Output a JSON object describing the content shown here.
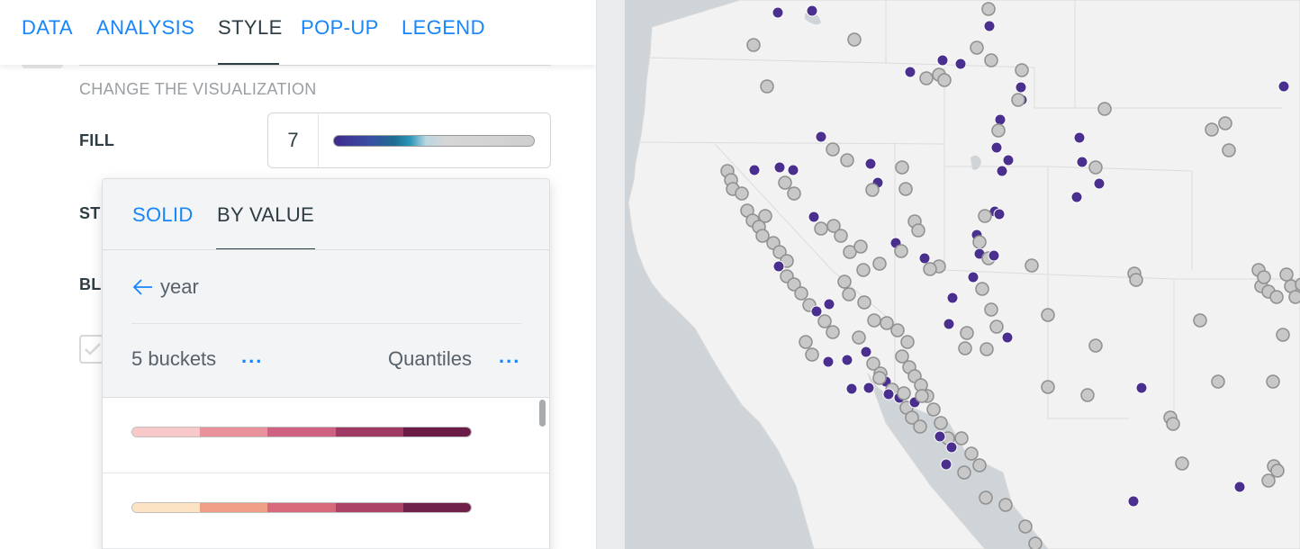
{
  "tabs": [
    {
      "label": "DATA",
      "active": false
    },
    {
      "label": "ANALYSIS",
      "active": false
    },
    {
      "label": "STYLE",
      "active": true
    },
    {
      "label": "POP-UP",
      "active": false
    },
    {
      "label": "LEGEND",
      "active": false
    }
  ],
  "style_panel": {
    "section_title": "CHANGE THE VISUALIZATION",
    "fill_label": "FILL",
    "stroke_label_visible": "ST",
    "blending_label_visible": "BL",
    "fill_count": "7"
  },
  "fill_popup": {
    "tabs": [
      "SOLID",
      "BY VALUE"
    ],
    "active_tab": "BY VALUE",
    "field": "year",
    "buckets": "5 buckets",
    "method": "Quantiles",
    "more_glyph": "...",
    "ramps": [
      {
        "colors": [
          "#f9c8c8",
          "#e9919d",
          "#cd6283",
          "#9e3a63",
          "#6a1e47"
        ]
      },
      {
        "colors": [
          "#fbe3c3",
          "#ee9f85",
          "#d8697a",
          "#ac4265",
          "#6f2049"
        ]
      }
    ]
  },
  "map": {
    "point_fill_gray": "#c8c8c8",
    "point_fill_purple": "#4a2f8e",
    "land_color": "#f2f2f2",
    "water_color": "#cfd4d8"
  }
}
